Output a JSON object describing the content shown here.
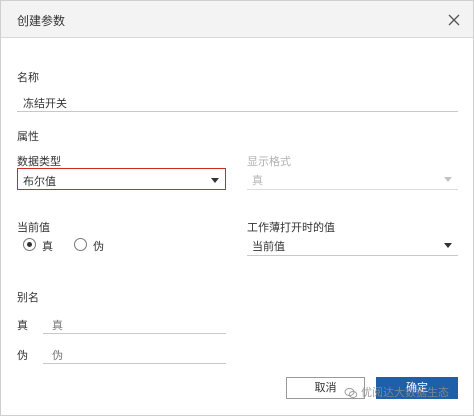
{
  "dialog": {
    "title": "创建参数",
    "close_icon": "close-icon"
  },
  "name": {
    "label": "名称",
    "value": "冻结开关"
  },
  "properties": {
    "label": "属性",
    "data_type_label": "数据类型",
    "data_type_value": "布尔值",
    "display_format_label": "显示格式",
    "display_format_value": "真"
  },
  "current_value": {
    "label": "当前值",
    "options": [
      {
        "label": "真",
        "selected": true
      },
      {
        "label": "伪",
        "selected": false
      }
    ]
  },
  "workbook_open": {
    "label": "工作薄打开时的值",
    "value": "当前值"
  },
  "aliases": {
    "label": "别名",
    "rows": [
      {
        "key": "真",
        "value": "真"
      },
      {
        "key": "伪",
        "value": "伪"
      }
    ]
  },
  "buttons": {
    "cancel": "取消",
    "ok": "确定"
  },
  "watermark": {
    "text": "优阅达大数据生态",
    "icon": "wechat-icon"
  }
}
